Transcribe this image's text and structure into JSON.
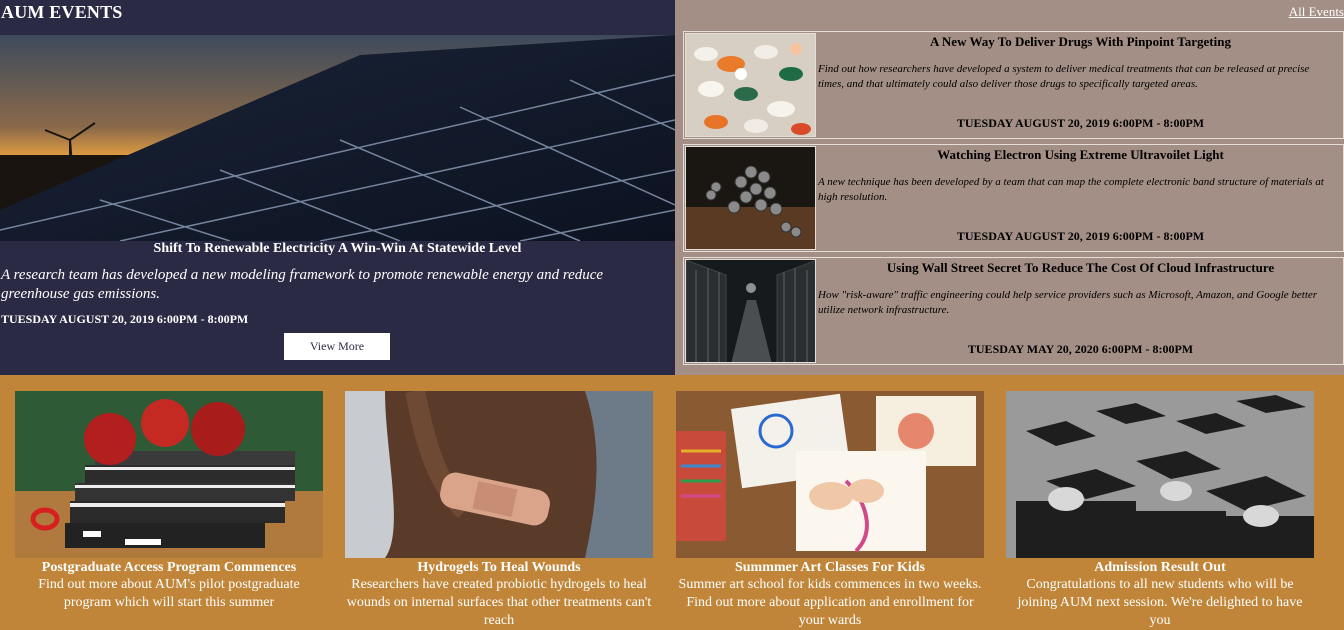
{
  "header": {
    "title": "AUM EVENTS",
    "all_events_label": "All Events"
  },
  "featured": {
    "title": "Shift To Renewable Electricity A Win-Win At Statewide Level",
    "description": "A research team has developed a new modeling framework to promote renewable energy and reduce greenhouse gas emissions.",
    "date": "TUESDAY AUGUST 20, 2019 6:00PM - 8:00PM",
    "button_label": "View More"
  },
  "events": [
    {
      "title": "A New Way To Deliver Drugs With Pinpoint Targeting",
      "description": "Find out how researchers have developed a system to deliver medical treatments that can be released at precise times, and that ultimately could also deliver those drugs to specifically targeted areas.",
      "date": "TUESDAY AUGUST 20, 2019 6:00PM - 8:00PM"
    },
    {
      "title": "Watching Electron Using Extreme Ultravoilet Light",
      "description": "A new technique has been developed by a team that can map the complete electronic band structure of materials at high resolution.",
      "date": "TUESDAY AUGUST 20, 2019 6:00PM - 8:00PM"
    },
    {
      "title": "Using Wall Street Secret To Reduce The Cost Of Cloud Infrastructure",
      "description": "How \"risk-aware\" traffic engineering could help service providers such as Microsoft, Amazon, and Google better utilize network infrastructure.",
      "date": "TUESDAY MAY 20, 2020 6:00PM - 8:00PM"
    }
  ],
  "news": [
    {
      "title": "Postgraduate Access Program Commences",
      "description": "Find out more about AUM's pilot postgraduate program which will start this summer"
    },
    {
      "title": "Hydrogels To Heal Wounds",
      "description": "Researchers have created probiotic hydrogels to heal wounds on internal surfaces that other treatments can't reach"
    },
    {
      "title": "Summmer Art Classes For Kids",
      "description": "Summer art school for kids commences in two weeks. Find out more about application and enrollment for your wards"
    },
    {
      "title": "Admission Result Out",
      "description": "Congratulations to all new students who will be joining AUM next session. We're delighted to have you"
    }
  ],
  "colors": {
    "left_panel": "#2b2a45",
    "right_panel": "#a38f85",
    "bottom_panel": "#c08538"
  }
}
